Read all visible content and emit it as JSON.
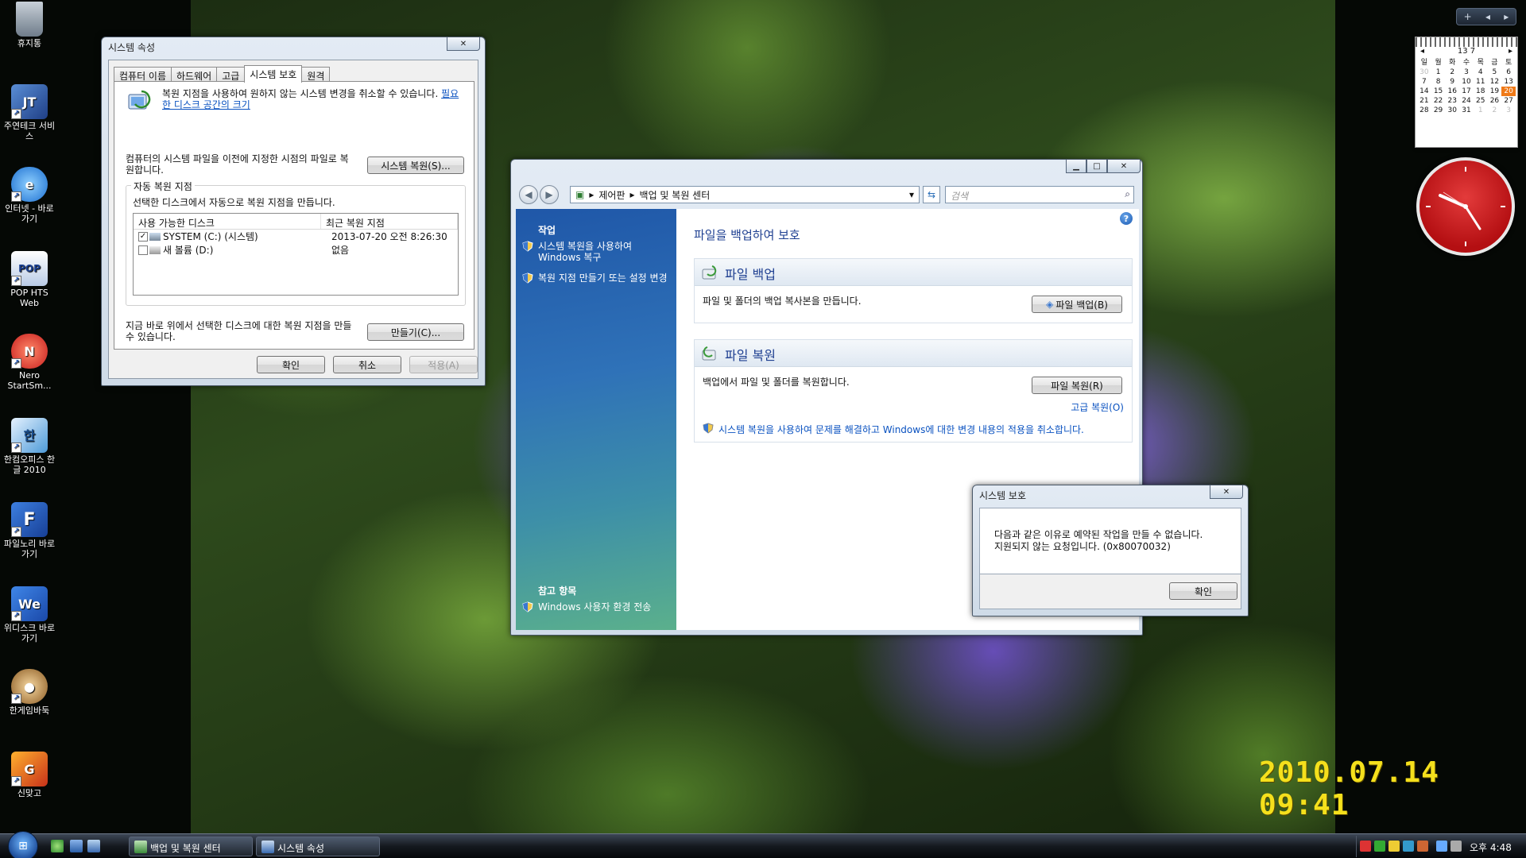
{
  "desktop": {
    "icons": [
      {
        "label": "휴지통"
      },
      {
        "label": "주연테크 서비스"
      },
      {
        "label": "인터넷 - 바로 가기"
      },
      {
        "label": "POP HTS Web"
      },
      {
        "label": "Nero StartSm..."
      },
      {
        "label": "한컴오피스 한글 2010"
      },
      {
        "label": "파일노리 바로가기"
      },
      {
        "label": "위디스크 바로가기"
      },
      {
        "label": "한게임바둑"
      },
      {
        "label": "신맞고"
      }
    ],
    "photo_stamp": "2010.07.14 09:41"
  },
  "system_properties": {
    "title": "시스템 속성",
    "tabs": [
      "컴퓨터 이름",
      "하드웨어",
      "고급",
      "시스템 보호",
      "원격"
    ],
    "active_tab": 3,
    "intro_text": "복원 지점을 사용하여 원하지 않는 시스템 변경을 취소할 수 있습니다.",
    "intro_link": "필요한 디스크 공간의 크기",
    "restore_text": "컴퓨터의 시스템 파일을 이전에 지정한 시점의 파일로 복원합니다.",
    "restore_button": "시스템 복원(S)...",
    "group_title": "자동 복원 지점",
    "group_desc": "선택한 디스크에서 자동으로 복원 지점을 만듭니다.",
    "columns": [
      "사용 가능한 디스크",
      "최근 복원 지점"
    ],
    "disks": [
      {
        "name": "SYSTEM (C:) (시스템)",
        "last": "2013-07-20 오전 8:26:30",
        "checked": true
      },
      {
        "name": "새 볼륨 (D:)",
        "last": "없음",
        "checked": false
      }
    ],
    "create_text": "지금 바로 위에서 선택한 디스크에 대한 복원 지점을 만들 수 있습니다.",
    "create_button": "만들기(C)...",
    "ok": "확인",
    "cancel": "취소",
    "apply": "적용(A)"
  },
  "backup_center": {
    "breadcrumb": [
      "제어판",
      "백업 및 복원 센터"
    ],
    "search_placeholder": "검색",
    "tasks_header": "작업",
    "tasks": [
      "시스템 복원을 사용하여 Windows 복구",
      "복원 지점 만들기 또는 설정 변경"
    ],
    "see_also_header": "참고 항목",
    "see_also": [
      "Windows 사용자 환경 전송"
    ],
    "page_title": "파일을 백업하여 보호",
    "backup_section": {
      "title": "파일 백업",
      "desc": "파일 및 폴더의 백업 복사본을 만듭니다.",
      "button": "파일 백업(B)"
    },
    "restore_section": {
      "title": "파일 복원",
      "desc": "백업에서 파일 및 폴더를 복원합니다.",
      "button": "파일 복원(R)",
      "advanced_link": "고급 복원(O)",
      "sysrestore_link": "시스템 복원을 사용하여 문제를 해결하고 Windows에 대한 변경 내용의 적용을 취소합니다."
    }
  },
  "protection_dialog": {
    "title": "시스템 보호",
    "message_line1": "다음과 같은 이유로 예약된 작업을 만들 수 없습니다.",
    "message_line2": "지원되지 않는 요청입니다. (0x80070032)",
    "ok": "확인"
  },
  "gadgets": {
    "calendar_month": "13 7",
    "calendar_weekdays": [
      "일",
      "월",
      "화",
      "수",
      "목",
      "금",
      "토"
    ],
    "calendar_days": [
      "30",
      "1",
      "2",
      "3",
      "4",
      "5",
      "6",
      "7",
      "8",
      "9",
      "10",
      "11",
      "12",
      "13",
      "14",
      "15",
      "16",
      "17",
      "18",
      "19",
      "20",
      "21",
      "22",
      "23",
      "24",
      "25",
      "26",
      "27",
      "28",
      "29",
      "30",
      "31",
      "1",
      "2",
      "3"
    ],
    "calendar_today": "20"
  },
  "taskbar": {
    "buttons": [
      "백업 및 복원 센터",
      "시스템 속성"
    ],
    "time": "오후 4:48"
  },
  "colors": {
    "link": "#0a52c0",
    "header_blue": "#1e3f91",
    "today": "#f07a18",
    "stamp": "#f5e01c"
  }
}
